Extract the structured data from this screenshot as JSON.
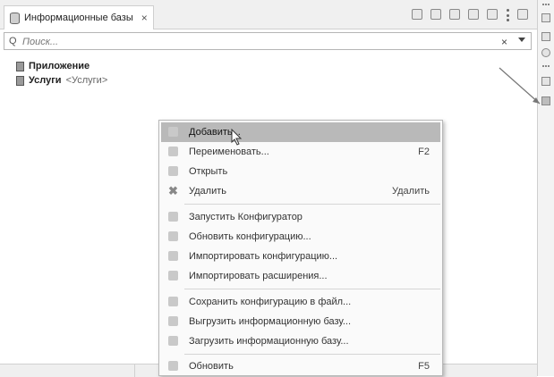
{
  "tab": {
    "title": "Информационные базы",
    "close": "×"
  },
  "toolbar": {
    "icons": [
      "list-view-icon",
      "settings-icon",
      "add-icon",
      "copy-icon",
      "group-icon",
      "more-icon",
      "pin-icon"
    ]
  },
  "search": {
    "prefix": "Q",
    "placeholder": "Поиск...",
    "clear": "×"
  },
  "tree": [
    {
      "name": "Приложение",
      "suffix": ""
    },
    {
      "name": "Услуги",
      "suffix": "<Услуги>"
    }
  ],
  "menu": {
    "items": [
      {
        "label": "Добавить...",
        "shortcut": "",
        "icon": "add-infobase-icon",
        "highlighted": true
      },
      {
        "label": "Переименовать...",
        "shortcut": "F2",
        "icon": "rename-icon"
      },
      {
        "label": "Открыть",
        "shortcut": "",
        "icon": "open-icon"
      },
      {
        "label": "Удалить",
        "shortcut": "Удалить",
        "icon": "delete-icon"
      },
      {
        "label": "Запустить Конфигуратор",
        "shortcut": "",
        "icon": "configurator-icon"
      },
      {
        "label": "Обновить конфигурацию...",
        "shortcut": "",
        "icon": "update-config-icon"
      },
      {
        "label": "Импортировать конфигурацию...",
        "shortcut": "",
        "icon": "import-config-icon"
      },
      {
        "label": "Импортировать расширения...",
        "shortcut": "",
        "icon": "import-extensions-icon"
      },
      {
        "label": "Сохранить конфигурацию в файл...",
        "shortcut": "",
        "icon": "save-config-icon"
      },
      {
        "label": "Выгрузить информационную базу...",
        "shortcut": "",
        "icon": "export-infobase-icon"
      },
      {
        "label": "Загрузить информационную базу...",
        "shortcut": "",
        "icon": "import-infobase-icon"
      },
      {
        "label": "Обновить",
        "shortcut": "F5",
        "icon": "refresh-icon"
      }
    ]
  }
}
